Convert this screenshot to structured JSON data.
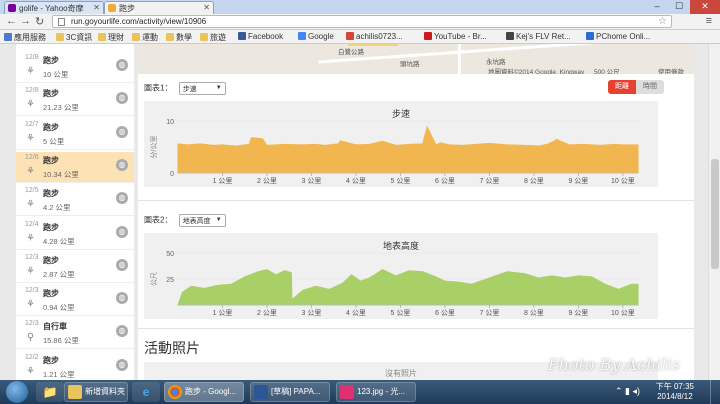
{
  "browser": {
    "tabs": [
      {
        "label": "golife - Yahoo奇摩",
        "active": false
      },
      {
        "label": "跑步",
        "active": true
      }
    ],
    "url": "run.goyourlife.com/activity/view/10906"
  },
  "bookmarks": [
    {
      "label": "應用服務",
      "icon": "apps-icon",
      "color": "#4a7bd1"
    },
    {
      "label": "3C資訊",
      "icon": "folder-icon",
      "color": "#e8c45a"
    },
    {
      "label": "理財",
      "icon": "folder-icon",
      "color": "#e8c45a"
    },
    {
      "label": "運動",
      "icon": "folder-icon",
      "color": "#e8c45a"
    },
    {
      "label": "數學",
      "icon": "folder-icon",
      "color": "#e8c45a"
    },
    {
      "label": "旅遊",
      "icon": "folder-icon",
      "color": "#e8c45a"
    },
    {
      "label": "Facebook",
      "icon": "facebook-icon",
      "color": "#3b5998"
    },
    {
      "label": "Google",
      "icon": "google-icon",
      "color": "#4285f4"
    },
    {
      "label": "achilis0723...",
      "icon": "gmail-icon",
      "color": "#d44638"
    },
    {
      "label": "YouTube - Br...",
      "icon": "youtube-icon",
      "color": "#cc181e"
    },
    {
      "label": "Kej's FLV Ret...",
      "icon": "k-icon",
      "color": "#444444"
    },
    {
      "label": "PChome Onli...",
      "icon": "pchome-icon",
      "color": "#2a6fcf"
    }
  ],
  "activities": [
    {
      "date": "12/8",
      "type": "跑步",
      "distance": "10 公里",
      "selected": false
    },
    {
      "date": "12/8",
      "type": "跑步",
      "distance": "21.23 公里",
      "selected": false
    },
    {
      "date": "12/7",
      "type": "跑步",
      "distance": "5 公里",
      "selected": false
    },
    {
      "date": "12/6",
      "type": "跑步",
      "distance": "10.34 公里",
      "selected": true
    },
    {
      "date": "12/5",
      "type": "跑步",
      "distance": "4.2 公里",
      "selected": false
    },
    {
      "date": "12/4",
      "type": "跑步",
      "distance": "4.28 公里",
      "selected": false
    },
    {
      "date": "12/3",
      "type": "跑步",
      "distance": "2.87 公里",
      "selected": false
    },
    {
      "date": "12/3",
      "type": "跑步",
      "distance": "0.94 公里",
      "selected": false
    },
    {
      "date": "12/3",
      "type": "自行車",
      "distance": "15.86 公里",
      "selected": false
    },
    {
      "date": "12/2",
      "type": "跑步",
      "distance": "1.21 公里",
      "selected": false
    }
  ],
  "map": {
    "labels": [
      "白鷺公路",
      "永坑路",
      "頭坑路",
      "地圖資料©2014 Google, Kingway",
      "500 公尺",
      "使用條款"
    ]
  },
  "chart1": {
    "select_label": "圖表1：",
    "select_value": "步速",
    "toggle_on": "距離",
    "toggle_off": "時間"
  },
  "chart2": {
    "select_label": "圖表2：",
    "select_value": "地表高度"
  },
  "photos": {
    "title": "活動照片",
    "empty": "沒有照片"
  },
  "watermark": "Photo By Achilis",
  "taskbar": {
    "buttons": [
      "新增資料夾",
      "跑步 - Googl...",
      "[草稿] PAPA...",
      "123.jpg - 光..."
    ],
    "time": "下午 07:35",
    "date": "2014/8/12"
  },
  "chart_data": [
    {
      "type": "area",
      "title": "步速",
      "ylabel": "分/公里",
      "color": "#f2b650",
      "ylim": [
        0,
        10
      ],
      "yticks": [
        0,
        10
      ],
      "xlabel": "",
      "x_tick_labels": [
        "1 公里",
        "2 公里",
        "3 公里",
        "4 公里",
        "5 公里",
        "6 公里",
        "7 公里",
        "8 公里",
        "9 公里",
        "10 公里"
      ],
      "x": [
        0,
        0.2,
        0.5,
        0.8,
        1.0,
        1.3,
        1.6,
        1.9,
        2.0,
        2.4,
        2.8,
        3.1,
        3.3,
        3.6,
        4.0,
        4.3,
        4.6,
        4.9,
        5.2,
        5.5,
        5.8,
        5.9,
        6.1,
        6.4,
        6.7,
        7.0,
        7.4,
        7.8,
        8.1,
        8.3,
        8.5,
        8.8,
        9.1,
        9.5,
        9.8,
        10.0,
        10.34
      ],
      "values": [
        5.6,
        5.4,
        5.6,
        5.3,
        5.4,
        5.2,
        5.5,
        6.6,
        5.3,
        5.5,
        5.4,
        5.5,
        5.3,
        5.6,
        5.4,
        5.5,
        6.1,
        5.3,
        5.5,
        5.6,
        5.4,
        5.8,
        5.4,
        5.3,
        5.5,
        5.7,
        5.4,
        5.3,
        5.2,
        5.5,
        6.3,
        5.4,
        5.5,
        5.3,
        5.5,
        5.4,
        5.4
      ],
      "spikes": [
        {
          "x": 1.65,
          "y": 6.8
        },
        {
          "x": 3.65,
          "y": 6.2
        },
        {
          "x": 5.6,
          "y": 8.9
        },
        {
          "x": 8.5,
          "y": 6.5
        }
      ]
    },
    {
      "type": "area",
      "title": "地表高度",
      "ylabel": "公尺",
      "color": "#a9cf67",
      "ylim": [
        0,
        50
      ],
      "yticks": [
        25,
        50
      ],
      "xlabel": "",
      "x_tick_labels": [
        "1 公里",
        "2 公里",
        "3 公里",
        "4 公里",
        "5 公里",
        "6 公里",
        "7 公里",
        "8 公里",
        "9 公里",
        "10 公里"
      ],
      "x": [
        0,
        0.1,
        0.3,
        0.6,
        0.9,
        1.2,
        1.5,
        1.8,
        2.0,
        2.2,
        2.4,
        2.55,
        2.56,
        2.8,
        3.1,
        3.4,
        3.7,
        3.9,
        4.1,
        4.3,
        4.6,
        4.9,
        5.2,
        5.5,
        5.8,
        6.0,
        6.3,
        6.6,
        7.0,
        7.4,
        7.8,
        8.1,
        8.4,
        8.7,
        9.0,
        9.3,
        9.6,
        9.9,
        10.2,
        10.34
      ],
      "values": [
        0,
        12,
        18,
        16,
        19,
        20,
        27,
        32,
        34,
        29,
        33,
        31,
        5,
        14,
        18,
        15,
        21,
        29,
        23,
        26,
        34,
        28,
        33,
        32,
        27,
        23,
        22,
        20,
        26,
        32,
        30,
        26,
        28,
        26,
        28,
        27,
        20,
        15,
        20,
        20
      ]
    }
  ]
}
